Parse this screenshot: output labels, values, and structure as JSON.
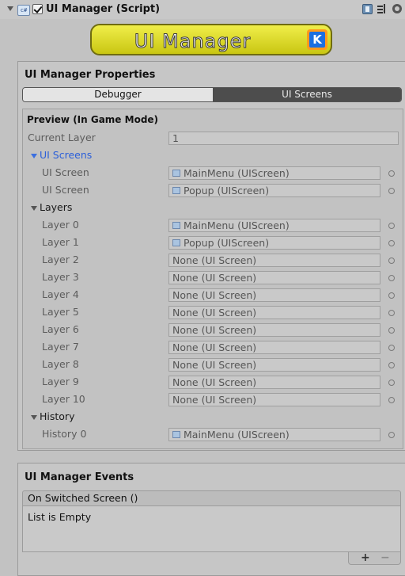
{
  "component": {
    "title": "UI Manager (Script)",
    "enabled": true,
    "icons": [
      "collapse-arrow-icon",
      "csharp-script-icon",
      "help-book-icon",
      "preset-icon",
      "gear-icon"
    ]
  },
  "banner": {
    "text": "UI Manager",
    "badge_letter": "K"
  },
  "properties": {
    "title": "UI Manager Properties",
    "tabs": [
      {
        "label": "Debugger",
        "selected": false
      },
      {
        "label": "UI Screens",
        "selected": true
      }
    ]
  },
  "preview": {
    "title": "Preview (In Game Mode)",
    "current_layer_label": "Current Layer",
    "current_layer_value": "1",
    "ui_screens": {
      "label": "UI Screens",
      "items": [
        {
          "label": "UI Screen",
          "value": "MainMenu (UIScreen)"
        },
        {
          "label": "UI Screen",
          "value": "Popup (UIScreen)"
        }
      ]
    },
    "layers": {
      "label": "Layers",
      "items": [
        {
          "label": "Layer 0",
          "value": "MainMenu (UIScreen)"
        },
        {
          "label": "Layer 1",
          "value": "Popup (UIScreen)"
        },
        {
          "label": "Layer 2",
          "value": "None (UI Screen)"
        },
        {
          "label": "Layer 3",
          "value": "None (UI Screen)"
        },
        {
          "label": "Layer 4",
          "value": "None (UI Screen)"
        },
        {
          "label": "Layer 5",
          "value": "None (UI Screen)"
        },
        {
          "label": "Layer 6",
          "value": "None (UI Screen)"
        },
        {
          "label": "Layer 7",
          "value": "None (UI Screen)"
        },
        {
          "label": "Layer 8",
          "value": "None (UI Screen)"
        },
        {
          "label": "Layer 9",
          "value": "None (UI Screen)"
        },
        {
          "label": "Layer 10",
          "value": "None (UI Screen)"
        }
      ]
    },
    "history": {
      "label": "History",
      "items": [
        {
          "label": "History 0",
          "value": "MainMenu (UIScreen)"
        }
      ]
    }
  },
  "events": {
    "title": "UI Manager Events",
    "event_name": "On Switched Screen ()",
    "empty_text": "List is Empty",
    "add_label": "+",
    "remove_label": "−"
  },
  "colors": {
    "background": "#c2c2c2",
    "link_blue": "#2b5fd9",
    "banner_yellow": "#e6e32c",
    "tab_selected": "#4d4d4d"
  }
}
